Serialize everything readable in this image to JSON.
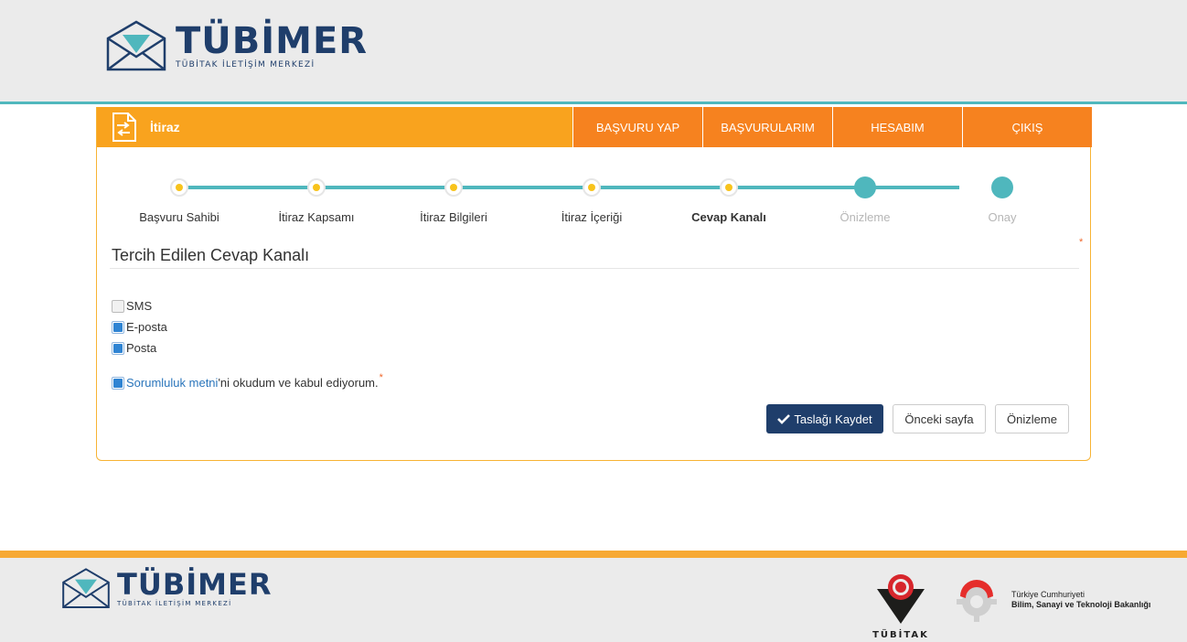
{
  "header": {
    "logo_title": "TÜBİMER",
    "logo_subtitle": "TÜBİTAK İLETİŞİM MERKEZİ"
  },
  "topbar": {
    "page_title": "İtiraz",
    "nav": [
      "BAŞVURU YAP",
      "BAŞVURULARIM",
      "HESABIM",
      "ÇIKIŞ"
    ]
  },
  "stepper": {
    "steps": [
      {
        "label": "Başvuru Sahibi",
        "state": "done"
      },
      {
        "label": "İtiraz Kapsamı",
        "state": "done"
      },
      {
        "label": "İtiraz Bilgileri",
        "state": "done"
      },
      {
        "label": "İtiraz İçeriği",
        "state": "done"
      },
      {
        "label": "Cevap Kanalı",
        "state": "current"
      },
      {
        "label": "Önizleme",
        "state": "todo"
      },
      {
        "label": "Onay",
        "state": "todo"
      }
    ]
  },
  "form": {
    "section_title": "Tercih Edilen Cevap Kanalı",
    "required_mark": "*",
    "options": [
      {
        "label": "SMS",
        "checked": false
      },
      {
        "label": "E-posta",
        "checked": true
      },
      {
        "label": "Posta",
        "checked": true
      }
    ],
    "agreement": {
      "link_text": "Sorumluluk metni",
      "rest_text": "'ni okudum ve kabul ediyorum.",
      "checked": true
    }
  },
  "actions": {
    "save_draft": "Taslağı Kaydet",
    "previous": "Önceki sayfa",
    "preview": "Önizleme"
  },
  "footer": {
    "logo_title": "TÜBİMER",
    "logo_subtitle": "TÜBİTAK İLETİŞİM MERKEZİ",
    "tubitak_label": "TÜBİTAK",
    "ministry_line1": "Türkiye Cumhuriyeti",
    "ministry_line2": "Bilim, Sanayi ve Teknoloji Bakanlığı"
  },
  "colors": {
    "accent_teal": "#4fb7bd",
    "orange": "#f9a31e",
    "dark_orange": "#f6821f",
    "navy": "#1f3e6b",
    "step_done_dot": "#f8c31c"
  }
}
